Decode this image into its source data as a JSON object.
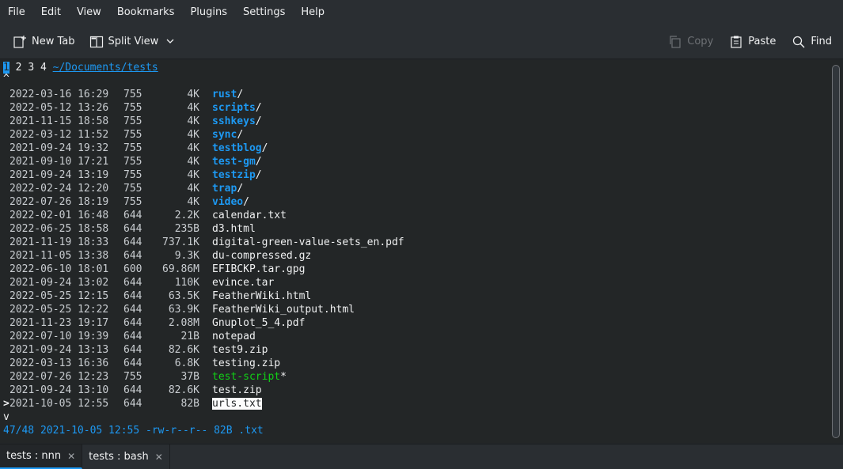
{
  "menu": [
    "File",
    "Edit",
    "View",
    "Bookmarks",
    "Plugins",
    "Settings",
    "Help"
  ],
  "toolbar": {
    "new_tab": "New Tab",
    "split_view": "Split View",
    "copy": "Copy",
    "paste": "Paste",
    "find": "Find"
  },
  "nnn": {
    "contexts": [
      "1",
      "2",
      "3",
      "4"
    ],
    "active_context": "1",
    "path": "~/Documents/tests",
    "up_marker": "^",
    "down_marker": "v",
    "cursor_marker": ">",
    "entries": [
      {
        "date": "2022-03-16 16:29",
        "perm": "755",
        "size": "4K",
        "name": "rust",
        "kind": "dir",
        "suffix": "/"
      },
      {
        "date": "2022-05-12 13:26",
        "perm": "755",
        "size": "4K",
        "name": "scripts",
        "kind": "dir",
        "suffix": "/"
      },
      {
        "date": "2021-11-15 18:58",
        "perm": "755",
        "size": "4K",
        "name": "sshkeys",
        "kind": "dir",
        "suffix": "/"
      },
      {
        "date": "2022-03-12 11:52",
        "perm": "755",
        "size": "4K",
        "name": "sync",
        "kind": "dir",
        "suffix": "/"
      },
      {
        "date": "2021-09-24 19:32",
        "perm": "755",
        "size": "4K",
        "name": "testblog",
        "kind": "dir",
        "suffix": "/"
      },
      {
        "date": "2021-09-10 17:21",
        "perm": "755",
        "size": "4K",
        "name": "test-gm",
        "kind": "dir",
        "suffix": "/"
      },
      {
        "date": "2021-09-24 13:19",
        "perm": "755",
        "size": "4K",
        "name": "testzip",
        "kind": "dir",
        "suffix": "/"
      },
      {
        "date": "2022-02-24 12:20",
        "perm": "755",
        "size": "4K",
        "name": "trap",
        "kind": "dir",
        "suffix": "/"
      },
      {
        "date": "2022-07-26 18:19",
        "perm": "755",
        "size": "4K",
        "name": "video",
        "kind": "dir",
        "suffix": "/"
      },
      {
        "date": "2022-02-01 16:48",
        "perm": "644",
        "size": "2.2K",
        "name": "calendar.txt",
        "kind": "file",
        "suffix": ""
      },
      {
        "date": "2022-06-25 18:58",
        "perm": "644",
        "size": "235B",
        "name": "d3.html",
        "kind": "file",
        "suffix": ""
      },
      {
        "date": "2021-11-19 18:33",
        "perm": "644",
        "size": "737.1K",
        "name": "digital-green-value-sets_en.pdf",
        "kind": "file",
        "suffix": ""
      },
      {
        "date": "2021-11-05 13:38",
        "perm": "644",
        "size": "9.3K",
        "name": "du-compressed.gz",
        "kind": "file",
        "suffix": ""
      },
      {
        "date": "2022-06-10 18:01",
        "perm": "600",
        "size": "69.86M",
        "name": "EFIBCKP.tar.gpg",
        "kind": "file",
        "suffix": ""
      },
      {
        "date": "2021-09-24 13:02",
        "perm": "644",
        "size": "110K",
        "name": "evince.tar",
        "kind": "file",
        "suffix": ""
      },
      {
        "date": "2022-05-25 12:15",
        "perm": "644",
        "size": "63.5K",
        "name": "FeatherWiki.html",
        "kind": "file",
        "suffix": ""
      },
      {
        "date": "2022-05-25 12:22",
        "perm": "644",
        "size": "63.9K",
        "name": "FeatherWiki_output.html",
        "kind": "file",
        "suffix": ""
      },
      {
        "date": "2021-11-23 19:17",
        "perm": "644",
        "size": "2.08M",
        "name": "Gnuplot_5_4.pdf",
        "kind": "file",
        "suffix": ""
      },
      {
        "date": "2022-07-10 19:39",
        "perm": "644",
        "size": "21B",
        "name": "notepad",
        "kind": "file",
        "suffix": ""
      },
      {
        "date": "2021-09-24 13:13",
        "perm": "644",
        "size": "82.6K",
        "name": "test9.zip",
        "kind": "file",
        "suffix": ""
      },
      {
        "date": "2022-03-13 16:36",
        "perm": "644",
        "size": "6.8K",
        "name": "testing.zip",
        "kind": "file",
        "suffix": ""
      },
      {
        "date": "2022-07-26 12:23",
        "perm": "755",
        "size": "37B",
        "name": "test-script",
        "kind": "exec",
        "suffix": "*"
      },
      {
        "date": "2021-09-24 13:10",
        "perm": "644",
        "size": "82.6K",
        "name": "test.zip",
        "kind": "file",
        "suffix": ""
      },
      {
        "date": "2021-10-05 12:55",
        "perm": "644",
        "size": "82B",
        "name": "urls.txt",
        "kind": "file",
        "suffix": "",
        "selected": true
      }
    ],
    "status": "47/48 2021-10-05 12:55 -rw-r--r-- 82B .txt"
  },
  "tabs": [
    {
      "label": "tests : nnn",
      "active": true
    },
    {
      "label": "tests : bash",
      "active": false
    }
  ],
  "colors": {
    "accent": "#1d99f3",
    "exec": "#11d116",
    "background": "#232627"
  }
}
